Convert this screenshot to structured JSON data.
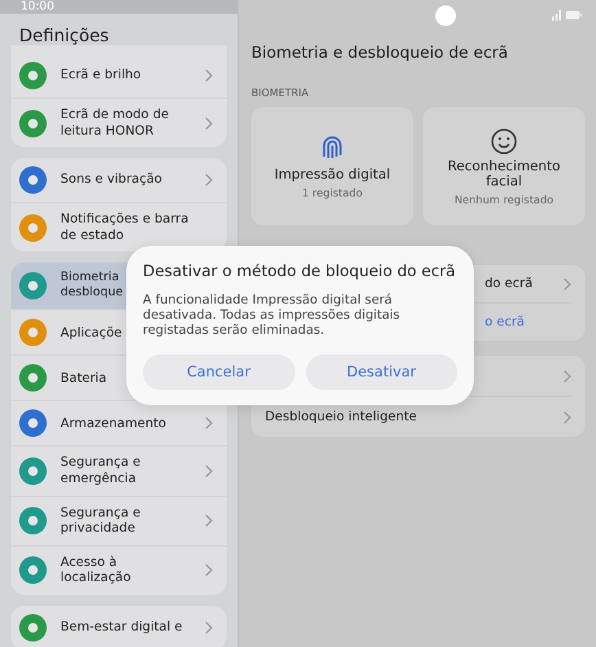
{
  "status_bar": {
    "time": "10:00"
  },
  "sidebar": {
    "title": "Definições",
    "groups": [
      {
        "items": [
          {
            "label": "Ecrã e brilho",
            "color": "#2a9a48",
            "selected": false,
            "chevron": true
          },
          {
            "label": "Ecrã de modo de leitura HONOR",
            "color": "#2a9a48",
            "selected": false,
            "chevron": true
          }
        ]
      },
      {
        "items": [
          {
            "label": "Sons e vibração",
            "color": "#2f6fce",
            "selected": false,
            "chevron": true
          },
          {
            "label": "Notificações e barra de estado",
            "color": "#e0900f",
            "selected": false,
            "chevron": false
          }
        ]
      },
      {
        "items": [
          {
            "label": "Biometria desbloque",
            "color": "#1f9a8c",
            "selected": true,
            "chevron": false
          },
          {
            "label": "Aplicaçõe",
            "color": "#e0900f",
            "selected": false,
            "chevron": false
          },
          {
            "label": "Bateria",
            "color": "#2a9a48",
            "selected": false,
            "chevron": false
          },
          {
            "label": "Armazenamento",
            "color": "#2f6fce",
            "selected": false,
            "chevron": true
          },
          {
            "label": "Segurança e emergência",
            "color": "#1f9a8c",
            "selected": false,
            "chevron": true
          },
          {
            "label": "Segurança e privacidade",
            "color": "#1f9a8c",
            "selected": false,
            "chevron": true
          },
          {
            "label": "Acesso à localização",
            "color": "#1f9a8c",
            "selected": false,
            "chevron": true
          }
        ]
      },
      {
        "items": [
          {
            "label": "Bem-estar digital e",
            "color": "#2a9a48",
            "selected": false,
            "chevron": true
          }
        ]
      }
    ]
  },
  "content": {
    "title": "Biometria e desbloqueio de ecrã",
    "section": "BIOMETRIA",
    "cards": [
      {
        "kind": "fingerprint",
        "title": "Impressão digital",
        "subtitle": "1 registado"
      },
      {
        "kind": "face",
        "title": "Reconhecimento facial",
        "subtitle": "Nenhum registado"
      }
    ],
    "groups": [
      {
        "rows": [
          {
            "kind": "item",
            "label": "do ecrã"
          },
          {
            "kind": "link",
            "label": "o ecrã"
          }
        ]
      },
      {
        "rows": [
          {
            "kind": "item",
            "label": ""
          },
          {
            "kind": "item",
            "label": "Desbloqueio inteligente"
          }
        ]
      }
    ]
  },
  "dialog": {
    "title": "Desativar o método de bloqueio do ecrã",
    "message": "A funcionalidade Impressão digital será desativada. Todas as impressões digitais registadas serão eliminadas.",
    "buttons": [
      "Cancelar",
      "Desativar"
    ]
  }
}
